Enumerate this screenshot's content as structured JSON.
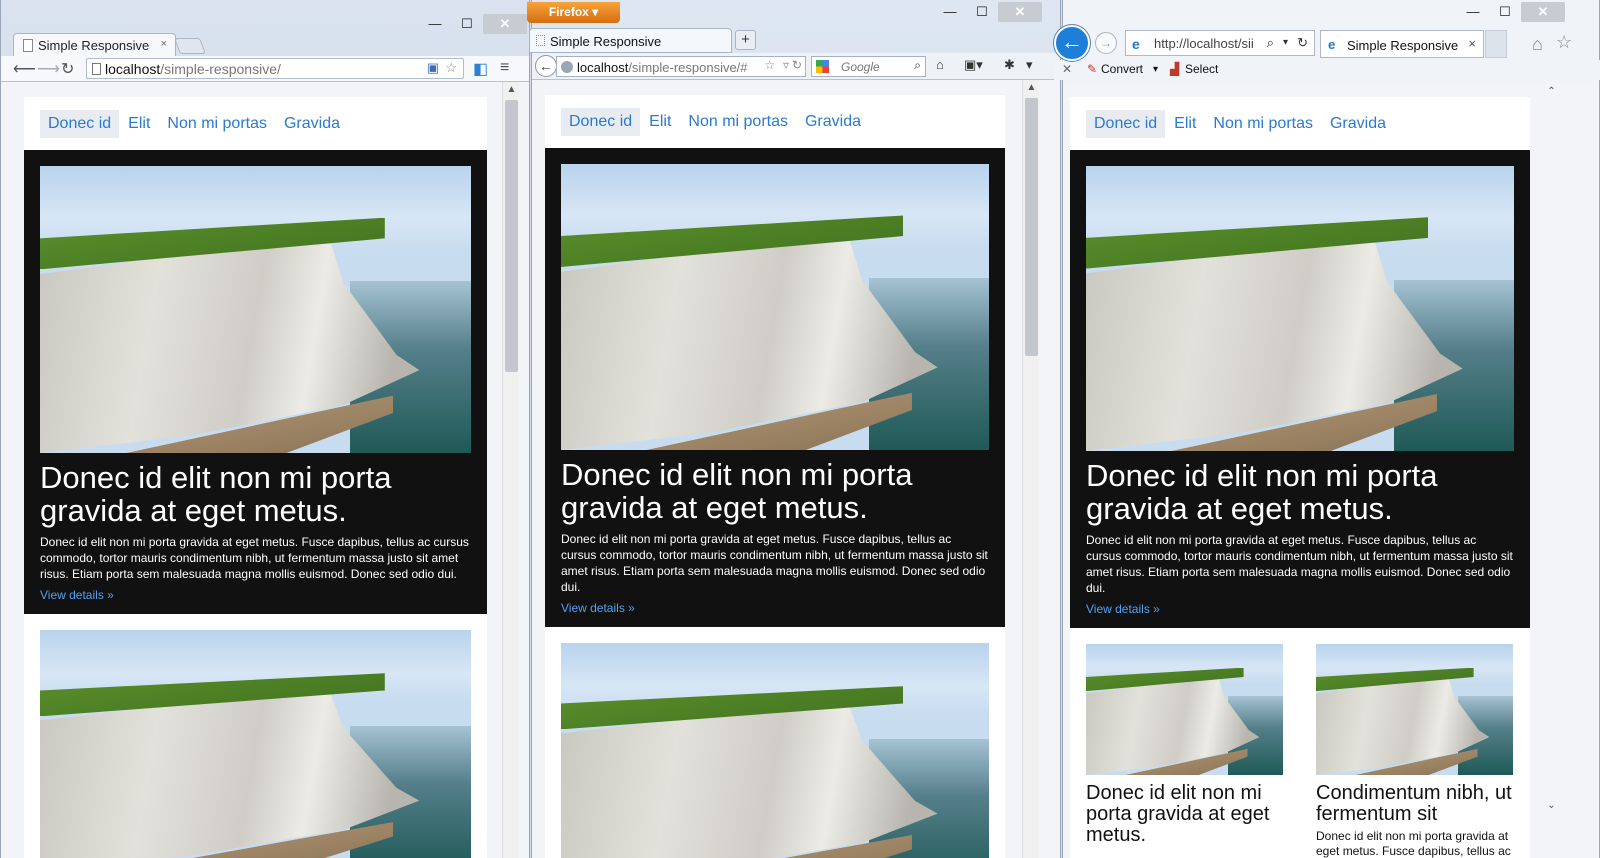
{
  "chrome": {
    "tab_title": "Simple Responsive",
    "tab_close": "×",
    "url_host": "localhost",
    "url_path": "/simple-responsive/",
    "minimize": "—",
    "maximize": "☐",
    "close": "✕"
  },
  "firefox": {
    "app_button": "Firefox ▾",
    "tab_title": "Simple Responsive",
    "new_tab": "+",
    "url_host": "localhost",
    "url_path": "/simple-responsive/#",
    "search_placeholder": "Google",
    "minimize": "—",
    "maximize": "☐",
    "close": "✕"
  },
  "ie": {
    "url": "http://localhost/sii",
    "tab_title": "Simple Responsive",
    "tab_close": "×",
    "cmd_x": "✕",
    "cmd_convert": "Convert",
    "cmd_select": "Select",
    "minimize": "—",
    "maximize": "☐",
    "close": "✕"
  },
  "site": {
    "nav": [
      "Donec id",
      "Elit",
      "Non mi portas",
      "Gravida"
    ],
    "hero_title": "Donec id elit non mi porta gravida at eget metus.",
    "hero_text": "Donec id elit non mi porta gravida at eget metus. Fusce dapibus, tellus ac cursus commodo, tortor mauris condimentum nibh, ut fermentum massa justo sit amet risus. Etiam porta sem malesuada magna mollis euismod. Donec sed odio dui.",
    "hero_link": "View details »",
    "col1_title": "Donec id elit non mi porta gravida at eget metus.",
    "col2_title": "Condimentum nibh, ut fermentum sit",
    "col_text": "Donec id elit non mi porta gravida at eget metus. Fusce dapibus, tellus ac"
  }
}
